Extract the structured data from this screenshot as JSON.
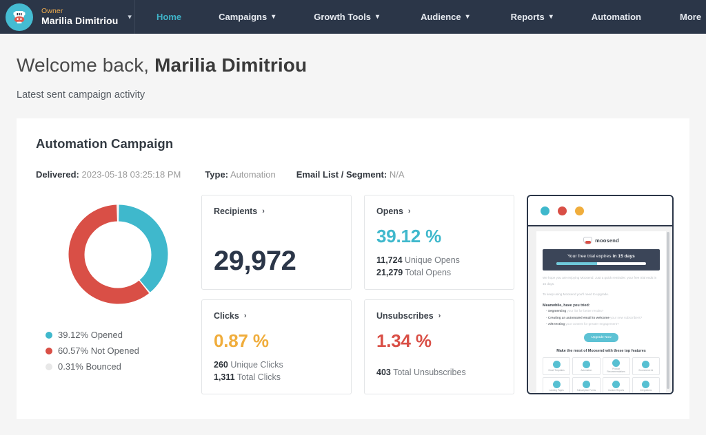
{
  "navbar": {
    "logo_icon": "moosend-cow-logo-icon",
    "account": {
      "role": "Owner",
      "name": "Marilia Dimitriou",
      "caret": "⌄"
    },
    "links": [
      {
        "label": "Home",
        "has_caret": false,
        "active": true
      },
      {
        "label": "Campaigns",
        "has_caret": true,
        "active": false
      },
      {
        "label": "Growth Tools",
        "has_caret": true,
        "active": false
      },
      {
        "label": "Audience",
        "has_caret": true,
        "active": false
      },
      {
        "label": "Reports",
        "has_caret": true,
        "active": false
      },
      {
        "label": "Automation",
        "has_caret": false,
        "active": false
      },
      {
        "label": "More",
        "has_caret": true,
        "active": false
      }
    ],
    "caret_glyph": "▾",
    "colors": {
      "background": "#2b3648",
      "active": "#3fb3c8",
      "role": "#f0ad4e"
    }
  },
  "header": {
    "welcome_prefix": "Welcome back, ",
    "user_name": "Marilia Dimitriou",
    "subtitle": "Latest sent campaign activity"
  },
  "campaign": {
    "title": "Automation Campaign",
    "meta": [
      {
        "label": "Delivered:",
        "value": "2023-05-18 03:25:18 PM"
      },
      {
        "label": "Type:",
        "value": "Automation"
      },
      {
        "label": "Email List / Segment:",
        "value": "N/A"
      }
    ]
  },
  "chart_data": {
    "type": "pie",
    "title": "",
    "categories": [
      "Opened",
      "Not Opened",
      "Bounced"
    ],
    "values": [
      39.12,
      60.57,
      0.31
    ],
    "colors": [
      "#3fb8cc",
      "#d94f46",
      "#e8e8e8"
    ],
    "legend": [
      {
        "text": "39.12% Opened",
        "color": "#3fb8cc"
      },
      {
        "text": "60.57% Not Opened",
        "color": "#d94f46"
      },
      {
        "text": "0.31% Bounced",
        "color": "#e8e8e8"
      }
    ],
    "legend_position": "bottom-left",
    "donut": true,
    "start_angle": 0
  },
  "stats": {
    "recipients": {
      "label": "Recipients",
      "chevron": "›",
      "value": "29,972"
    },
    "opens": {
      "label": "Opens",
      "chevron": "›",
      "percent": "39.12 %",
      "unique_value": "11,724",
      "unique_label": " Unique Opens",
      "total_value": "21,279",
      "total_label": " Total Opens"
    },
    "clicks": {
      "label": "Clicks",
      "chevron": "›",
      "percent": "0.87 %",
      "unique_value": "260",
      "unique_label": " Unique Clicks",
      "total_value": "1,311",
      "total_label": " Total Clicks"
    },
    "unsubscribes": {
      "label": "Unsubscribes",
      "chevron": "›",
      "percent": "1.34 %",
      "total_value": "403",
      "total_label": " Total Unsubscribes"
    }
  },
  "preview": {
    "window_dots": [
      "#3fb8cc",
      "#d94f46",
      "#f0ad3c"
    ],
    "brand": "moosend",
    "banner_text": "Your free trial expires ",
    "banner_strong": "in 15 days",
    "progress_percent": 45,
    "paragraph_1": "We hope you are enjoying Moosend. Just a quick reminder: your free trial ends in 15 days.",
    "paragraph_2": "To keep using Moosend you'll need to upgrade.",
    "heading": "Meanwhile, have you tried:",
    "bullets": [
      {
        "strong": "Segmenting",
        "rest": " your list for better results?"
      },
      {
        "strong": "Creating an automated email to welcome",
        "rest": " your new subscribers?"
      },
      {
        "strong": "A/B testing",
        "rest": " your content for greater engagement?"
      }
    ],
    "cta_label": "Upgrade Now",
    "features_title": "Make the most of Moosend with these top features",
    "features": [
      "Email Templates",
      "Automation",
      "Product Recommendations",
      "Ecommerce AI",
      "Landing Pages",
      "Subscription Forms",
      "Custom Reports",
      "Integrations"
    ]
  }
}
